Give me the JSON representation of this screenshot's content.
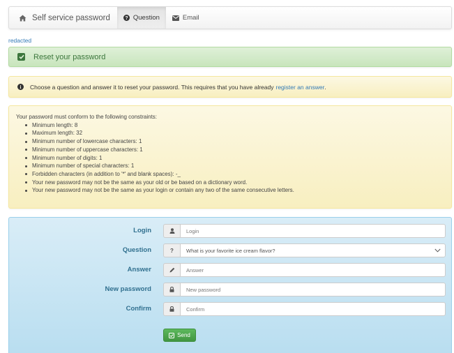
{
  "navbar": {
    "brand": {
      "label": "Self service password",
      "icon": "home-icon"
    },
    "tabs": [
      {
        "label": "Question",
        "icon": "question-circle-icon",
        "active": true
      },
      {
        "label": "Email",
        "icon": "envelope-icon",
        "active": false
      }
    ]
  },
  "redacted_link": "redacted",
  "success_alert": {
    "text": "Reset your password",
    "icon": "check-square-icon"
  },
  "info_alert": {
    "text": "Choose a question and answer it to reset your password. This requires that you have already",
    "link_text": "register an answer",
    "suffix": ".",
    "icon": "info-circle-icon"
  },
  "constraints": {
    "heading": "Your password must conform to the following constraints:",
    "items": [
      "Minimum length: 8",
      "Maximum length: 32",
      "Minimum number of lowercase characters: 1",
      "Minimum number of uppercase characters: 1",
      "Minimum number of digits: 1",
      "Minimum number of special characters: 1",
      "Forbidden characters (in addition to '*' and blank spaces): -_",
      "Your new password may not be the same as your old or be based on a dictionary word.",
      "Your new password may not be the same as your login or contain any two of the same consecutive letters."
    ]
  },
  "form": {
    "login": {
      "label": "Login",
      "placeholder": "Login",
      "icon": "user-icon"
    },
    "question": {
      "label": "Question",
      "selected": "What is your favorite ice cream flavor?",
      "icon": "question-icon"
    },
    "answer": {
      "label": "Answer",
      "placeholder": "Answer",
      "icon": "pencil-icon"
    },
    "new_password": {
      "label": "New password",
      "placeholder": "New password",
      "icon": "lock-icon"
    },
    "confirm": {
      "label": "Confirm",
      "placeholder": "Confirm",
      "icon": "lock-icon"
    },
    "send_label": "Send"
  },
  "colors": {
    "link": "#337ab7",
    "success_text": "#3c763d",
    "form_label": "#31708f",
    "send_button": "#5cb85c"
  }
}
